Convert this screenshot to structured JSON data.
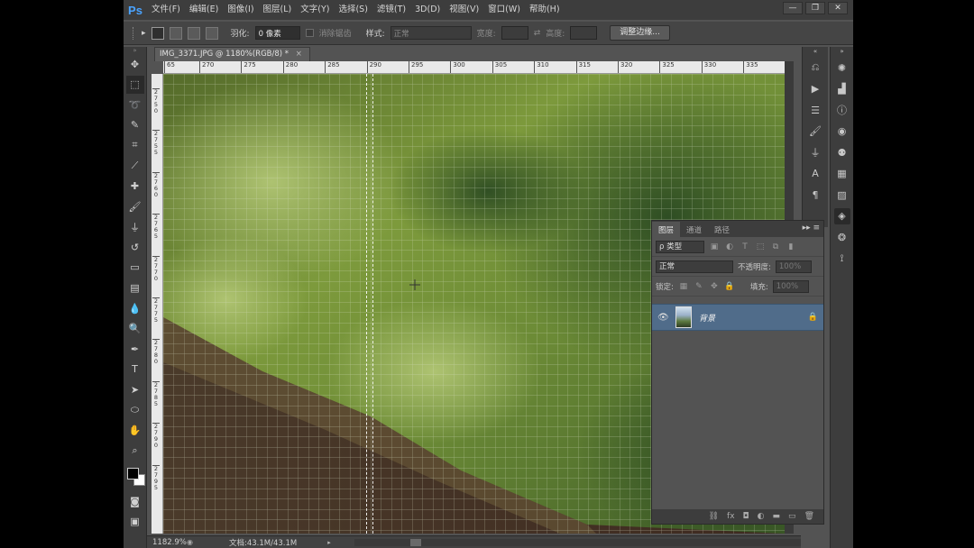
{
  "app": {
    "logo": "Ps"
  },
  "menu": [
    "文件(F)",
    "编辑(E)",
    "图像(I)",
    "图层(L)",
    "文字(Y)",
    "选择(S)",
    "滤镜(T)",
    "3D(D)",
    "视图(V)",
    "窗口(W)",
    "帮助(H)"
  ],
  "window_controls": [
    "minimize-icon",
    "restore-icon",
    "close-icon"
  ],
  "options": {
    "feather_label": "羽化:",
    "feather_value": "0 像素",
    "antialias_label": "消除锯齿",
    "style_label": "样式:",
    "style_value": "正常",
    "width_label": "宽度:",
    "height_label": "高度:",
    "refine_edge": "调整边缘..."
  },
  "document": {
    "tab_title": "IMG_3371.JPG @ 1180%(RGB/8) *",
    "close": "×"
  },
  "ruler_h": [
    "65",
    "270",
    "275",
    "280",
    "285",
    "290",
    "295",
    "300",
    "305",
    "310",
    "315",
    "320",
    "325",
    "330",
    "335"
  ],
  "ruler_v": [
    "2750",
    "2755",
    "2760",
    "2765",
    "2770",
    "2775",
    "2780",
    "2785",
    "2790",
    "2795"
  ],
  "layers": {
    "tabs": [
      "图层",
      "通道",
      "路径"
    ],
    "filter_label": "ρ 类型",
    "blend_mode": "正常",
    "opacity_label": "不透明度:",
    "opacity_value": "100%",
    "lock_label": "锁定:",
    "fill_label": "填充:",
    "fill_value": "100%",
    "layer_name": "背景"
  },
  "status": {
    "zoom": "1182.9%",
    "doc_info": "文档:43.1M/43.1M"
  },
  "colors": {
    "accent": "#4aa3ff",
    "selected_layer": "#506c8a"
  }
}
